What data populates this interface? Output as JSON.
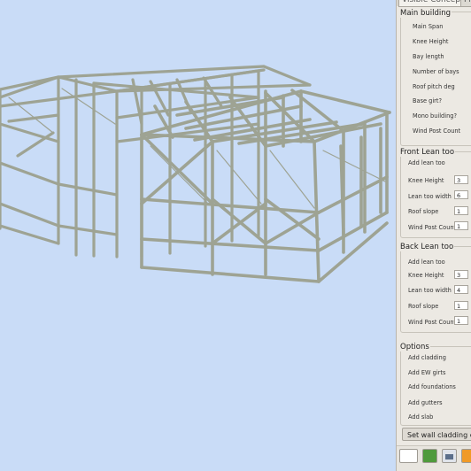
{
  "tabs": [
    "Visible Concepts",
    "Pr"
  ],
  "main_building": {
    "title": "Main building",
    "fields": [
      "Main Span",
      "Knee Height",
      "Bay length",
      "Number of bays",
      "Roof pitch deg",
      "Base girt?",
      "Mono building?",
      "Wind Post Count"
    ]
  },
  "front_lean_too": {
    "title": "Front Lean too",
    "add_label": "Add lean too",
    "fields": [
      {
        "label": "Knee Height",
        "value": "3"
      },
      {
        "label": "Lean too width",
        "value": "6"
      },
      {
        "label": "Roof slope",
        "value": "1"
      },
      {
        "label": "Wind Post Count",
        "value": "1"
      }
    ]
  },
  "back_lean_too": {
    "title": "Back Lean too",
    "add_label": "Add lean too",
    "fields": [
      {
        "label": "Knee Height",
        "value": "3"
      },
      {
        "label": "Lean too width",
        "value": "4"
      },
      {
        "label": "Roof slope",
        "value": "1"
      },
      {
        "label": "Wind Post Count",
        "value": "1"
      }
    ]
  },
  "options": {
    "title": "Options",
    "items": [
      "Add cladding",
      "Add EW girts",
      "Add foundations",
      "Add gutters",
      "Add slab"
    ]
  },
  "set_wall_cladding_button": "Set wall cladding c",
  "bottom_bar": {
    "icons": [
      "blank-field",
      "green-map-icon",
      "printer-icon",
      "folder-icon"
    ]
  },
  "colors": {
    "viewport_bg": "#c9dcf7",
    "steel": "#9ea393",
    "panel_bg": "#ece9e3"
  }
}
